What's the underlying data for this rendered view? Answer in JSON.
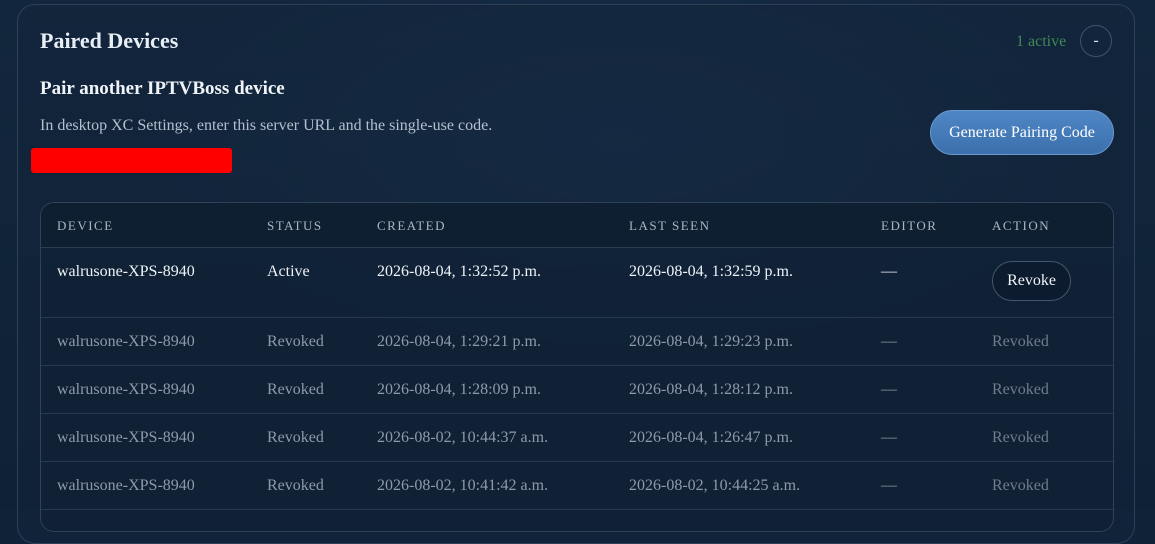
{
  "panel": {
    "title": "Paired Devices",
    "active_count": "1 active",
    "collapse_label": "-"
  },
  "pairing": {
    "title": "Pair another IPTVBoss device",
    "description": "In desktop XC Settings, enter this server URL and the single-use code.",
    "generate_button": "Generate Pairing Code"
  },
  "table": {
    "headers": {
      "device": "DEVICE",
      "status": "STATUS",
      "created": "CREATED",
      "last_seen": "LAST SEEN",
      "editor": "EDITOR",
      "action": "ACTION"
    },
    "rows": [
      {
        "device": "walrusone-XPS-8940",
        "status": "Active",
        "created": "2026-08-04, 1:32:52 p.m.",
        "last_seen": "2026-08-04, 1:32:59 p.m.",
        "editor": "—",
        "action": "Revoke"
      },
      {
        "device": "walrusone-XPS-8940",
        "status": "Revoked",
        "created": "2026-08-04, 1:29:21 p.m.",
        "last_seen": "2026-08-04, 1:29:23 p.m.",
        "editor": "—",
        "action": "Revoked"
      },
      {
        "device": "walrusone-XPS-8940",
        "status": "Revoked",
        "created": "2026-08-04, 1:28:09 p.m.",
        "last_seen": "2026-08-04, 1:28:12 p.m.",
        "editor": "—",
        "action": "Revoked"
      },
      {
        "device": "walrusone-XPS-8940",
        "status": "Revoked",
        "created": "2026-08-02, 10:44:37 a.m.",
        "last_seen": "2026-08-04, 1:26:47 p.m.",
        "editor": "—",
        "action": "Revoked"
      },
      {
        "device": "walrusone-XPS-8940",
        "status": "Revoked",
        "created": "2026-08-02, 10:41:42 a.m.",
        "last_seen": "2026-08-02, 10:44:25 a.m.",
        "editor": "—",
        "action": "Revoked"
      }
    ]
  },
  "colors": {
    "background": "#0f2238",
    "accent_button": "#4a7fbd",
    "active_count": "#3f8a55",
    "redaction": "#ff0000"
  }
}
